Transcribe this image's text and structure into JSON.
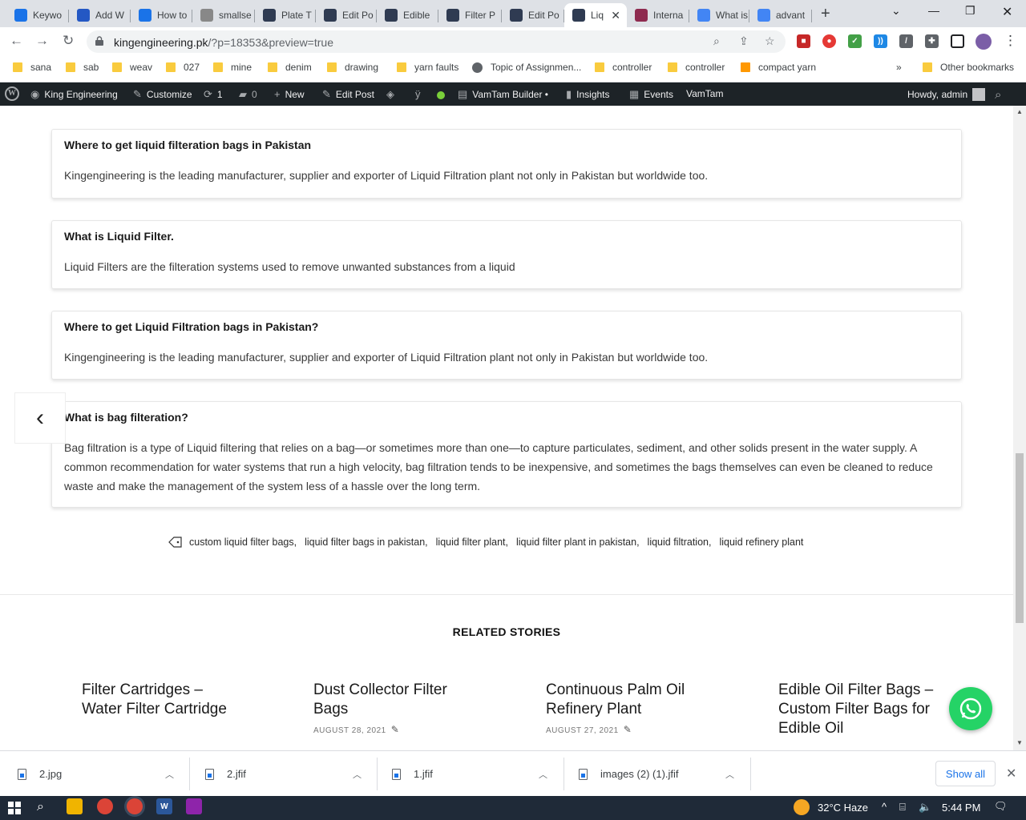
{
  "tabs": [
    {
      "label": "Keywo",
      "icon": "semrush-s-icon",
      "color": "#1a73e8"
    },
    {
      "label": "Add W",
      "icon": "wordtune-w-icon",
      "color": "#2458c4"
    },
    {
      "label": "How to",
      "icon": "semrush-s-icon",
      "color": "#1a73e8"
    },
    {
      "label": "smallse",
      "icon": "sst-icon",
      "color": "#888888"
    },
    {
      "label": "Plate T",
      "icon": "kingengineering-icon",
      "color": "#2f3b52"
    },
    {
      "label": "Edit Po",
      "icon": "kingengineering-icon",
      "color": "#2f3b52"
    },
    {
      "label": "Edible",
      "icon": "kingengineering-icon",
      "color": "#2f3b52"
    },
    {
      "label": "Filter P",
      "icon": "kingengineering-icon",
      "color": "#2f3b52"
    },
    {
      "label": "Edit Po",
      "icon": "kingengineering-icon",
      "color": "#2f3b52"
    },
    {
      "label": "Liq",
      "icon": "kingengineering-icon",
      "color": "#2f3b52",
      "active": true
    },
    {
      "label": "Interna",
      "icon": "wv-icon",
      "color": "#8e2a4f"
    },
    {
      "label": "What is",
      "icon": "google-g-icon",
      "color": "#4285f4"
    },
    {
      "label": "advant",
      "icon": "google-g-icon",
      "color": "#4285f4"
    }
  ],
  "browser": {
    "url_host": "kingengineering.pk",
    "url_path": "/?p=18353&preview=true"
  },
  "bookmarks": [
    "sana",
    "sab",
    "weav",
    "027",
    "mine",
    "denim",
    "drawing",
    "yarn faults",
    "Topic of Assignmen...",
    "controller",
    "controller",
    "compact yarn"
  ],
  "bookmarks_other": "Other bookmarks",
  "bookmarks_more": "»",
  "adminbar": {
    "site": "King Engineering",
    "customize": "Customize",
    "updates": "1",
    "comments": "0",
    "new": "New",
    "edit_post": "Edit Post",
    "vamtam_builder": "VamTam Builder •",
    "insights": "Insights",
    "events": "Events",
    "vamtam": "VamTam",
    "howdy": "Howdy, admin"
  },
  "faqs": [
    {
      "q": "Where to get liquid filteration bags in Pakistan",
      "a": "Kingengineering is the leading manufacturer, supplier and exporter of Liquid Filtration plant not only in Pakistan but worldwide too."
    },
    {
      "q": "What is Liquid Filter.",
      "a": "Liquid Filters are the filteration systems used to remove unwanted substances from a liquid"
    },
    {
      "q": "Where to get Liquid Filtration bags in Pakistan?",
      "a": "Kingengineering is the leading manufacturer, supplier and exporter of Liquid Filtration plant not only in Pakistan but worldwide too."
    },
    {
      "q": "What is bag filteration?",
      "a": "Bag filtration is a type of Liquid filtering that relies on a bag—or sometimes more than one—to capture particulates, sediment, and other solids present in the water supply. A common recommendation for water systems that run a high velocity, bag filtration tends to be inexpensive, and sometimes the bags themselves can even be cleaned to reduce waste and make the management of the system less of a hassle over the long term."
    }
  ],
  "tags": [
    "custom liquid filter bags,",
    "liquid filter bags in pakistan,",
    "liquid filter plant,",
    "liquid filter plant in pakistan,",
    "liquid filtration,",
    "liquid refinery plant"
  ],
  "related_title": "RELATED STORIES",
  "stories": [
    {
      "title": "Filter Cartridges – Water Filter Cartridge",
      "date": ""
    },
    {
      "title": "Dust Collector Filter Bags",
      "date": "AUGUST 28, 2021"
    },
    {
      "title": "Continuous Palm Oil Refinery Plant",
      "date": "AUGUST 27, 2021"
    },
    {
      "title": "Edible Oil Filter Bags – Custom Filter Bags for Edible Oil",
      "date": ""
    }
  ],
  "downloads": [
    "2.jpg",
    "2.jfif",
    "1.jfif",
    "images (2) (1).jfif"
  ],
  "downloads_show_all": "Show all",
  "taskbar": {
    "weather": "32°C  Haze",
    "time": "5:44 PM"
  }
}
